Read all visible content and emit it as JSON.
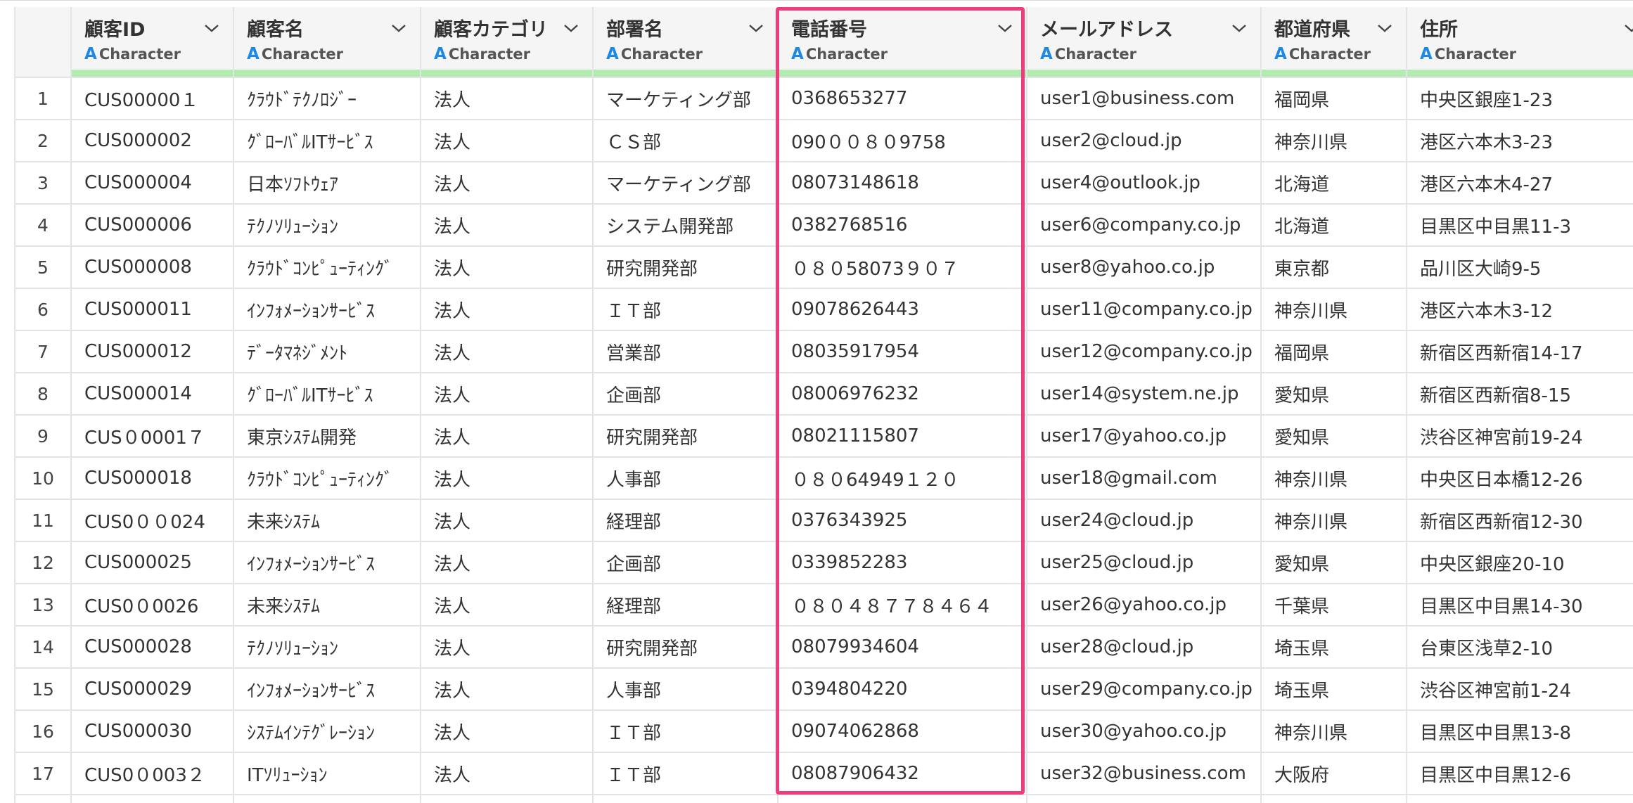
{
  "colors": {
    "highlight": "#ee3d7c",
    "quality_bar": "#b2ecb0",
    "type_icon": "#1e88e5"
  },
  "columns": [
    {
      "name": "顧客ID",
      "type": "Character"
    },
    {
      "name": "顧客名",
      "type": "Character"
    },
    {
      "name": "顧客カテゴリ",
      "type": "Character"
    },
    {
      "name": "部署名",
      "type": "Character"
    },
    {
      "name": "電話番号",
      "type": "Character"
    },
    {
      "name": "メールアドレス",
      "type": "Character"
    },
    {
      "name": "都道府県",
      "type": "Character"
    },
    {
      "name": "住所",
      "type": "Character"
    }
  ],
  "type_icon_glyph": "A",
  "rows": [
    {
      "n": "1",
      "cells": [
        "CUS00000１",
        "ｸﾗｳﾄﾞﾃｸﾉﾛｼﾞｰ",
        "法人",
        "マーケティング部",
        "0368653277",
        "user1@business.com",
        "福岡県",
        "中央区銀座1-23"
      ]
    },
    {
      "n": "2",
      "cells": [
        "CUS000002",
        "ｸﾞﾛｰﾊﾞﾙITｻｰﾋﾞｽ",
        "法人",
        "ＣＳ部",
        "090００８０9758",
        "user2@cloud.jp",
        "神奈川県",
        "港区六本木3-23"
      ]
    },
    {
      "n": "3",
      "cells": [
        "CUS000004",
        "日本ｿﾌﾄｳｪｱ",
        "法人",
        "マーケティング部",
        "08073148618",
        "user4@outlook.jp",
        "北海道",
        "港区六本木4-27"
      ]
    },
    {
      "n": "4",
      "cells": [
        "CUS000006",
        "ﾃｸﾉｿﾘｭｰｼｮﾝ",
        "法人",
        "システム開発部",
        "0382768516",
        "user6@company.co.jp",
        "北海道",
        "目黒区中目黒11-3"
      ]
    },
    {
      "n": "5",
      "cells": [
        "CUS000008",
        "ｸﾗｳﾄﾞｺﾝﾋﾟｭｰﾃｨﾝｸﾞ",
        "法人",
        "研究開発部",
        "０８０58073９０７",
        "user8@yahoo.co.jp",
        "東京都",
        "品川区大崎9-5"
      ]
    },
    {
      "n": "6",
      "cells": [
        "CUS000011",
        "ｲﾝﾌｫﾒｰｼｮﾝｻｰﾋﾞｽ",
        "法人",
        "ＩＴ部",
        "09078626443",
        "user11@company.co.jp",
        "神奈川県",
        "港区六本木3-12"
      ]
    },
    {
      "n": "7",
      "cells": [
        "CUS000012",
        "ﾃﾞｰﾀﾏﾈｼﾞﾒﾝﾄ",
        "法人",
        "営業部",
        "08035917954",
        "user12@company.co.jp",
        "福岡県",
        "新宿区西新宿14-17"
      ]
    },
    {
      "n": "8",
      "cells": [
        "CUS000014",
        "ｸﾞﾛｰﾊﾞﾙITｻｰﾋﾞｽ",
        "法人",
        "企画部",
        "08006976232",
        "user14@system.ne.jp",
        "愛知県",
        "新宿区西新宿8-15"
      ]
    },
    {
      "n": "9",
      "cells": [
        "CUS０0001７",
        "東京ｼｽﾃﾑ開発",
        "法人",
        "研究開発部",
        "08021115807",
        "user17@yahoo.co.jp",
        "愛知県",
        "渋谷区神宮前19-24"
      ]
    },
    {
      "n": "10",
      "cells": [
        "CUS000018",
        "ｸﾗｳﾄﾞｺﾝﾋﾟｭｰﾃｨﾝｸﾞ",
        "法人",
        "人事部",
        "０８０64949１２０",
        "user18@gmail.com",
        "神奈川県",
        "中央区日本橋12-26"
      ]
    },
    {
      "n": "11",
      "cells": [
        "CUS0００024",
        "未来ｼｽﾃﾑ",
        "法人",
        "経理部",
        "0376343925",
        "user24@cloud.jp",
        "神奈川県",
        "新宿区西新宿12-30"
      ]
    },
    {
      "n": "12",
      "cells": [
        "CUS000025",
        "ｲﾝﾌｫﾒｰｼｮﾝｻｰﾋﾞｽ",
        "法人",
        "企画部",
        "0339852283",
        "user25@cloud.jp",
        "愛知県",
        "中央区銀座20-10"
      ]
    },
    {
      "n": "13",
      "cells": [
        "CUS0０0026",
        "未来ｼｽﾃﾑ",
        "法人",
        "経理部",
        "０８０４８７７８４６４",
        "user26@yahoo.co.jp",
        "千葉県",
        "目黒区中目黒14-30"
      ]
    },
    {
      "n": "14",
      "cells": [
        "CUS000028",
        "ﾃｸﾉｿﾘｭｰｼｮﾝ",
        "法人",
        "研究開発部",
        "08079934604",
        "user28@cloud.jp",
        "埼玉県",
        "台東区浅草2-10"
      ]
    },
    {
      "n": "15",
      "cells": [
        "CUS000029",
        "ｲﾝﾌｫﾒｰｼｮﾝｻｰﾋﾞｽ",
        "法人",
        "人事部",
        "0394804220",
        "user29@company.co.jp",
        "埼玉県",
        "渋谷区神宮前1-24"
      ]
    },
    {
      "n": "16",
      "cells": [
        "CUS000030",
        "ｼｽﾃﾑｲﾝﾃｸﾞﾚｰｼｮﾝ",
        "法人",
        "ＩＴ部",
        "09074062868",
        "user30@yahoo.co.jp",
        "神奈川県",
        "目黒区中目黒13-8"
      ]
    },
    {
      "n": "17",
      "cells": [
        "CUS0０003２",
        "ITｿﾘｭｰｼｮﾝ",
        "法人",
        "ＩＴ部",
        "08087906432",
        "user32@business.com",
        "大阪府",
        "目黒区中目黒12-6"
      ]
    }
  ]
}
